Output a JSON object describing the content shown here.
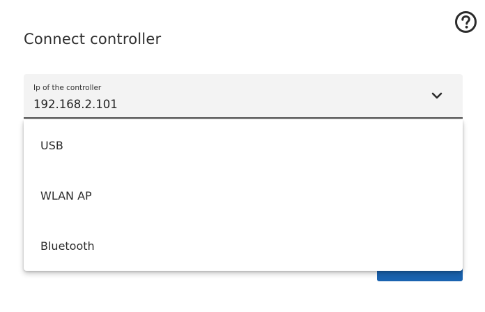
{
  "dialog": {
    "title": "Connect controller",
    "help_icon": "question-circle-icon"
  },
  "controller_select": {
    "label": "Ip of the controller",
    "value": "192.168.2.101",
    "icon": "chevron-down-icon",
    "options": [
      {
        "label": "USB"
      },
      {
        "label": "WLAN AP"
      },
      {
        "label": "Bluetooth"
      }
    ]
  },
  "colors": {
    "primary_button": "#1a63b0",
    "field_background": "#f3f3f3",
    "field_underline": "#4a4a4a"
  }
}
